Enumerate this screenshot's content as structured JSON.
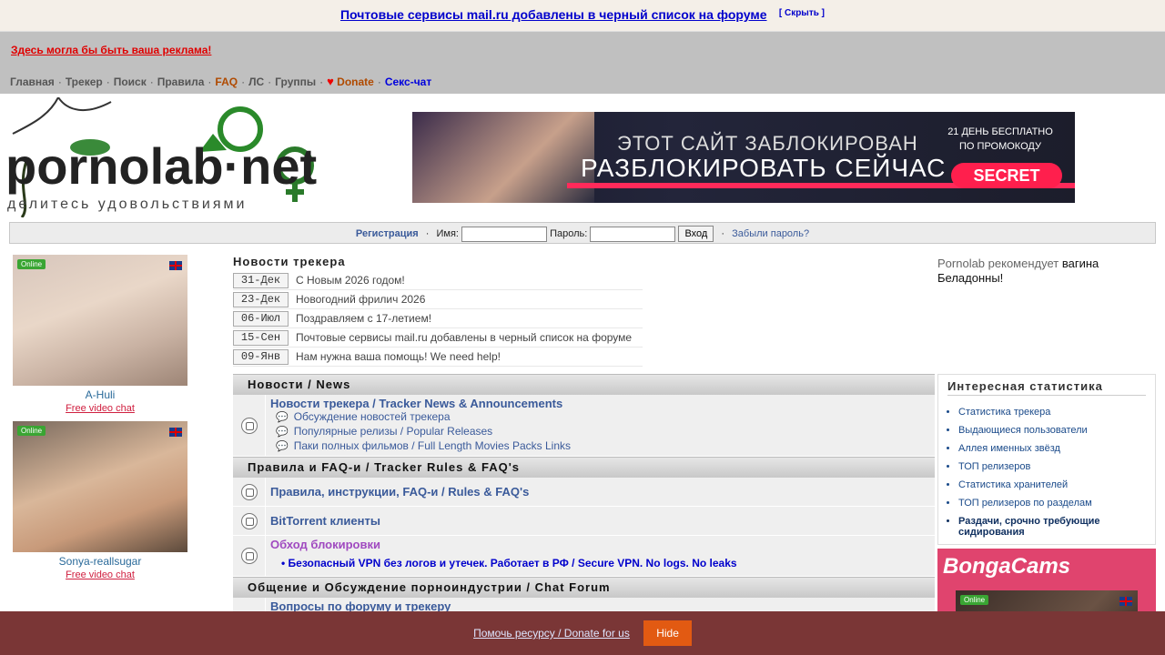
{
  "announcement": {
    "text": "Почтовые сервисы mail.ru добавлены в черный список на форуме",
    "hide": "[ Скрыть ]"
  },
  "ad_text": "Здесь могла бы быть ваша реклама!",
  "nav": {
    "home": "Главная",
    "tracker": "Трекер",
    "search": "Поиск",
    "rules": "Правила",
    "faq": "FAQ",
    "pm": "ЛС",
    "groups": "Группы",
    "donate": "Donate",
    "sexchat": "Секс-чат",
    "sep": "·"
  },
  "logo": {
    "text": "pornolab·net",
    "tagline": "делитесь удовольствиями"
  },
  "banner": {
    "line1": "ЭТОТ САЙТ ЗАБЛОКИРОВАН",
    "line2": "РАЗБЛОКИРОВАТЬ СЕЙЧАС",
    "promo": "21 ДЕНЬ БЕСПЛАТНО ПО ПРОМОКОДУ",
    "button": "SECRET"
  },
  "login": {
    "register": "Регистрация",
    "name_label": "Имя:",
    "pass_label": "Пароль:",
    "submit": "Вход",
    "forgot": "Забыли пароль?",
    "dot": "·"
  },
  "cams": [
    {
      "online": "Online",
      "name": "A-Huli",
      "link": "Free video chat"
    },
    {
      "online": "Online",
      "name": "Sonya-reallsugar",
      "link": "Free video chat"
    }
  ],
  "news": {
    "title": "Новости трекера",
    "items": [
      {
        "date": "31-Дек",
        "text": "С Новым 2026 годом!"
      },
      {
        "date": "23-Дек",
        "text": "Новогодний фрилич 2026"
      },
      {
        "date": "06-Июл",
        "text": "Поздравляем с 17-летием!"
      },
      {
        "date": "15-Сен",
        "text": "Почтовые сервисы mail.ru добавлены в черный список на форуме"
      },
      {
        "date": "09-Янв",
        "text": "Нам нужна ваша помощь! We need help!"
      }
    ]
  },
  "recommend": {
    "prefix": "Pornolab рекомендует",
    "link": "вагина Беладонны!"
  },
  "forum": {
    "cat1": "Новости / News",
    "f1": {
      "title": "Новости трекера / Tracker News & Announcements",
      "subs": [
        "Обсуждение новостей трекера",
        "Популярные релизы / Popular Releases",
        "Паки полных фильмов / Full Length Movies Packs Links"
      ]
    },
    "cat2": "Правила и FAQ-и / Tracker Rules & FAQ's",
    "f2": "Правила, инструкции, FAQ-и / Rules & FAQ's",
    "f3": "BitTorrent клиенты",
    "f4": {
      "title": "Обход блокировки",
      "vpn": "• Безопасный VPN без логов и утечек. Работает в РФ / Secure VPN. No logs. No leaks"
    },
    "cat3": "Общение и Обсуждение порноиндустрии / Chat Forum",
    "f5": "Вопросы по форуму и трекеру"
  },
  "stats": {
    "title": "Интересная статистика",
    "items": [
      "Статистика трекера",
      "Выдающиеся пользователи",
      "Аллея именных звёзд",
      "ТОП релизеров",
      "Статистика хранителей",
      "ТОП релизеров по разделам",
      "Раздачи, срочно требующие сидирования"
    ]
  },
  "bonga": {
    "logo": "BongaCams",
    "online": "Online"
  },
  "footer": {
    "donate": "Помочь ресурсу / Donate for us",
    "hide": "Hide"
  }
}
